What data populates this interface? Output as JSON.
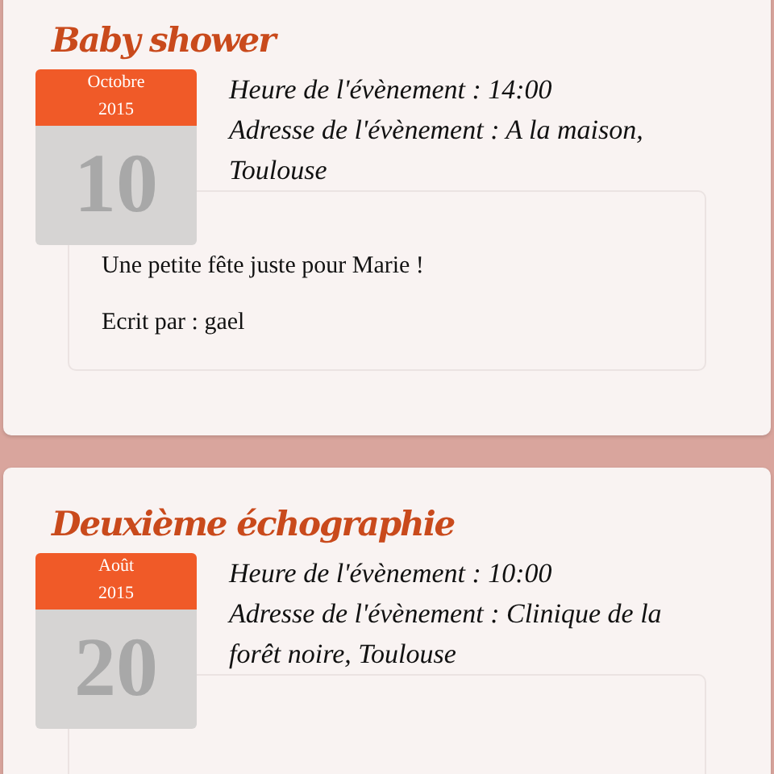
{
  "events": [
    {
      "title": "Baby shower",
      "month": "Octobre",
      "year": "2015",
      "day": "10",
      "time": "Heure de l'évènement : 14:00",
      "address": "Adresse de l'évènement : A la maison, Toulouse",
      "description": "Une petite fête juste pour Marie !",
      "author": "Ecrit par : gael"
    },
    {
      "title": "Deuxième échographie",
      "month": "Août",
      "year": "2015",
      "day": "20",
      "time": "Heure de l'évènement : 10:00",
      "address": "Adresse de l'évènement : Clinique de la forêt noire, Toulouse"
    }
  ]
}
